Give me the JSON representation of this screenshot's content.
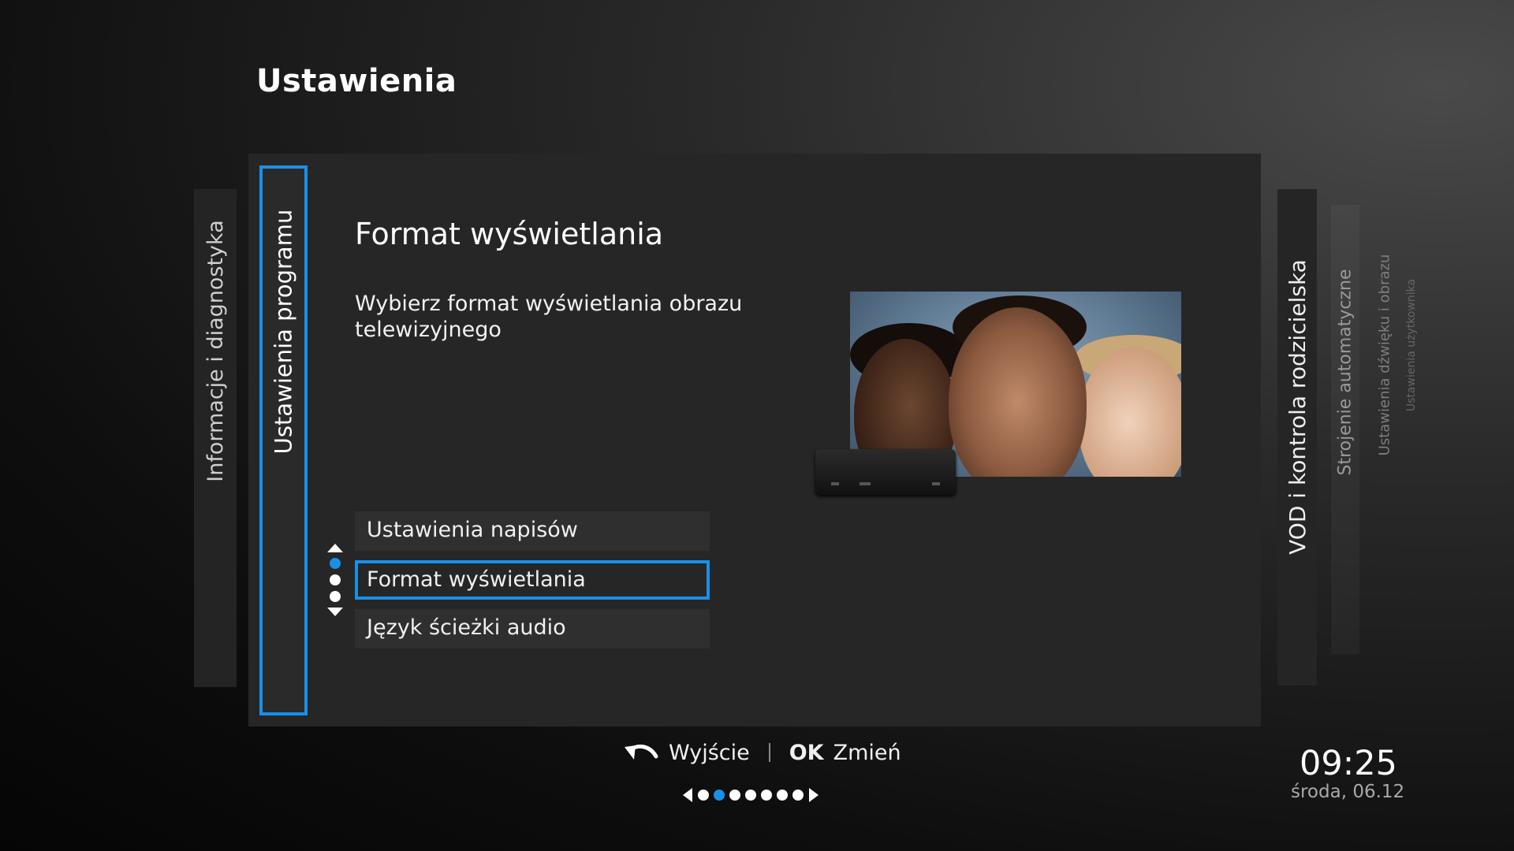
{
  "page": {
    "title": "Ustawienia"
  },
  "left_tabs": [
    {
      "label": "Informacje i diagnostyka"
    },
    {
      "label": "Ustawienia programu",
      "active": true
    }
  ],
  "detail": {
    "title": "Format wyświetlania",
    "description": "Wybierz format wyświetlania obrazu telewizyjnego"
  },
  "menu": {
    "items": [
      {
        "label": "Ustawienia napisów"
      },
      {
        "label": "Format wyświetlania",
        "selected": true
      },
      {
        "label": "Język ścieżki audio"
      }
    ],
    "scroll_position": 1,
    "scroll_total": 3
  },
  "right_tabs": [
    {
      "label": "VOD i kontrola rodzicielska"
    },
    {
      "label": "Strojenie automatyczne"
    },
    {
      "label": "Ustawienia dźwięku i obrazu"
    },
    {
      "label": "Ustawienia użytkownika"
    }
  ],
  "footer": {
    "back_label": "Wyjście",
    "ok_key": "OK",
    "ok_label": "Zmień",
    "pager_total": 7,
    "pager_current": 2
  },
  "clock": {
    "time": "09:25",
    "date": "środa, 06.12"
  },
  "colors": {
    "accent": "#1a8fe8"
  },
  "icons": {
    "back": "back-arrow-icon",
    "scroll_up": "triangle-up-icon",
    "scroll_down": "triangle-down-icon"
  }
}
